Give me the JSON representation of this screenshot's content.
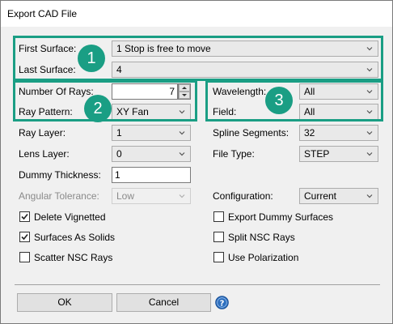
{
  "window": {
    "title": "Export CAD File"
  },
  "fields": {
    "first_surface": {
      "label": "First Surface:",
      "value": "1 Stop is free to move"
    },
    "last_surface": {
      "label": "Last Surface:",
      "value": "4"
    },
    "number_of_rays": {
      "label": "Number Of Rays:",
      "value": "7"
    },
    "ray_pattern": {
      "label": "Ray Pattern:",
      "value": "XY Fan"
    },
    "wavelength": {
      "label": "Wavelength:",
      "value": "All"
    },
    "field": {
      "label": "Field:",
      "value": "All"
    },
    "ray_layer": {
      "label": "Ray Layer:",
      "value": "1"
    },
    "spline_segments": {
      "label": "Spline Segments:",
      "value": "32"
    },
    "lens_layer": {
      "label": "Lens Layer:",
      "value": "0"
    },
    "file_type": {
      "label": "File Type:",
      "value": "STEP"
    },
    "dummy_thickness": {
      "label": "Dummy Thickness:",
      "value": "1"
    },
    "angular_tolerance": {
      "label": "Angular Tolerance:",
      "value": "Low"
    },
    "configuration": {
      "label": "Configuration:",
      "value": "Current"
    }
  },
  "checkboxes": {
    "delete_vignetted": {
      "label": "Delete Vignetted",
      "checked": true
    },
    "surfaces_as_solids": {
      "label": "Surfaces As Solids",
      "checked": true
    },
    "scatter_nsc_rays": {
      "label": "Scatter NSC Rays",
      "checked": false
    },
    "export_dummy_surfaces": {
      "label": "Export Dummy Surfaces",
      "checked": false
    },
    "split_nsc_rays": {
      "label": "Split NSC Rays",
      "checked": false
    },
    "use_polarization": {
      "label": "Use Polarization",
      "checked": false
    }
  },
  "buttons": {
    "ok": "OK",
    "cancel": "Cancel"
  },
  "callouts": {
    "one": "1",
    "two": "2",
    "three": "3"
  },
  "colors": {
    "callout": "#1a9e84"
  },
  "icons": {
    "help": "question-circle-icon"
  }
}
